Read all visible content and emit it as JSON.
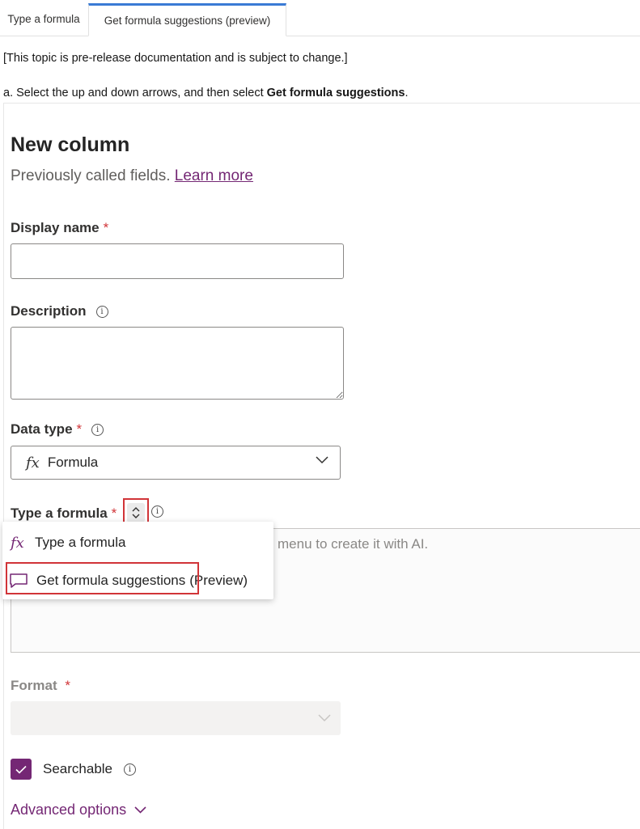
{
  "tabs": [
    {
      "label": "Type a formula",
      "active": false
    },
    {
      "label": "Get formula suggestions (preview)",
      "active": true
    }
  ],
  "intro": {
    "notice": "[This topic is pre-release documentation and is subject to change.]",
    "step_prefix": "a. Select the up and down arrows, and then select ",
    "step_bold": "Get formula suggestions",
    "step_suffix": "."
  },
  "form": {
    "title": "New column",
    "subtitle_text": "Previously called fields. ",
    "learn_more": "Learn more",
    "display_name_label": "Display name",
    "description_label": "Description",
    "data_type_label": "Data type",
    "data_type_icon": "fx",
    "data_type_value": "Formula",
    "formula_label": "Type a formula",
    "formula_hint": "menu to create it with AI.",
    "format_label": "Format",
    "required_mark": "*",
    "info_glyph": "i",
    "searchable_label": "Searchable",
    "searchable_checked": true,
    "advanced_label": "Advanced options"
  },
  "menu": {
    "items": [
      {
        "icon": "fx",
        "label": "Type a formula"
      },
      {
        "icon": "chat-icon",
        "label": "Get formula suggestions",
        "suffix": "(Preview)"
      }
    ]
  },
  "colors": {
    "accent": "#742774",
    "required": "#d13438",
    "tab_active": "#3a7bd5"
  }
}
